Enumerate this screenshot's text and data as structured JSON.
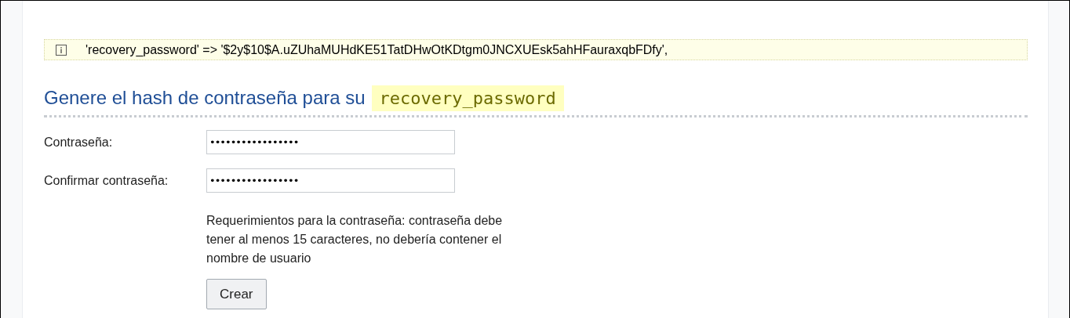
{
  "notice": {
    "text": "'recovery_password' => '$2y$10$A.uZUhaMUHdKE51TatDHwOtKDtgm0JNCXUEsk5ahHFauraxqbFDfy',"
  },
  "heading": {
    "text": "Genere el hash de contraseña para su",
    "code": "recovery_password"
  },
  "fields": [
    {
      "label": "Contraseña:",
      "value": "•••••••••••••••••"
    },
    {
      "label": "Confirmar contraseña:",
      "value": "•••••••••••••••••"
    }
  ],
  "requirements": "Requerimientos para la contraseña: contraseña debe tener al menos 15 caracteres, no debería contener el nombre de usuario",
  "button": "Crear"
}
